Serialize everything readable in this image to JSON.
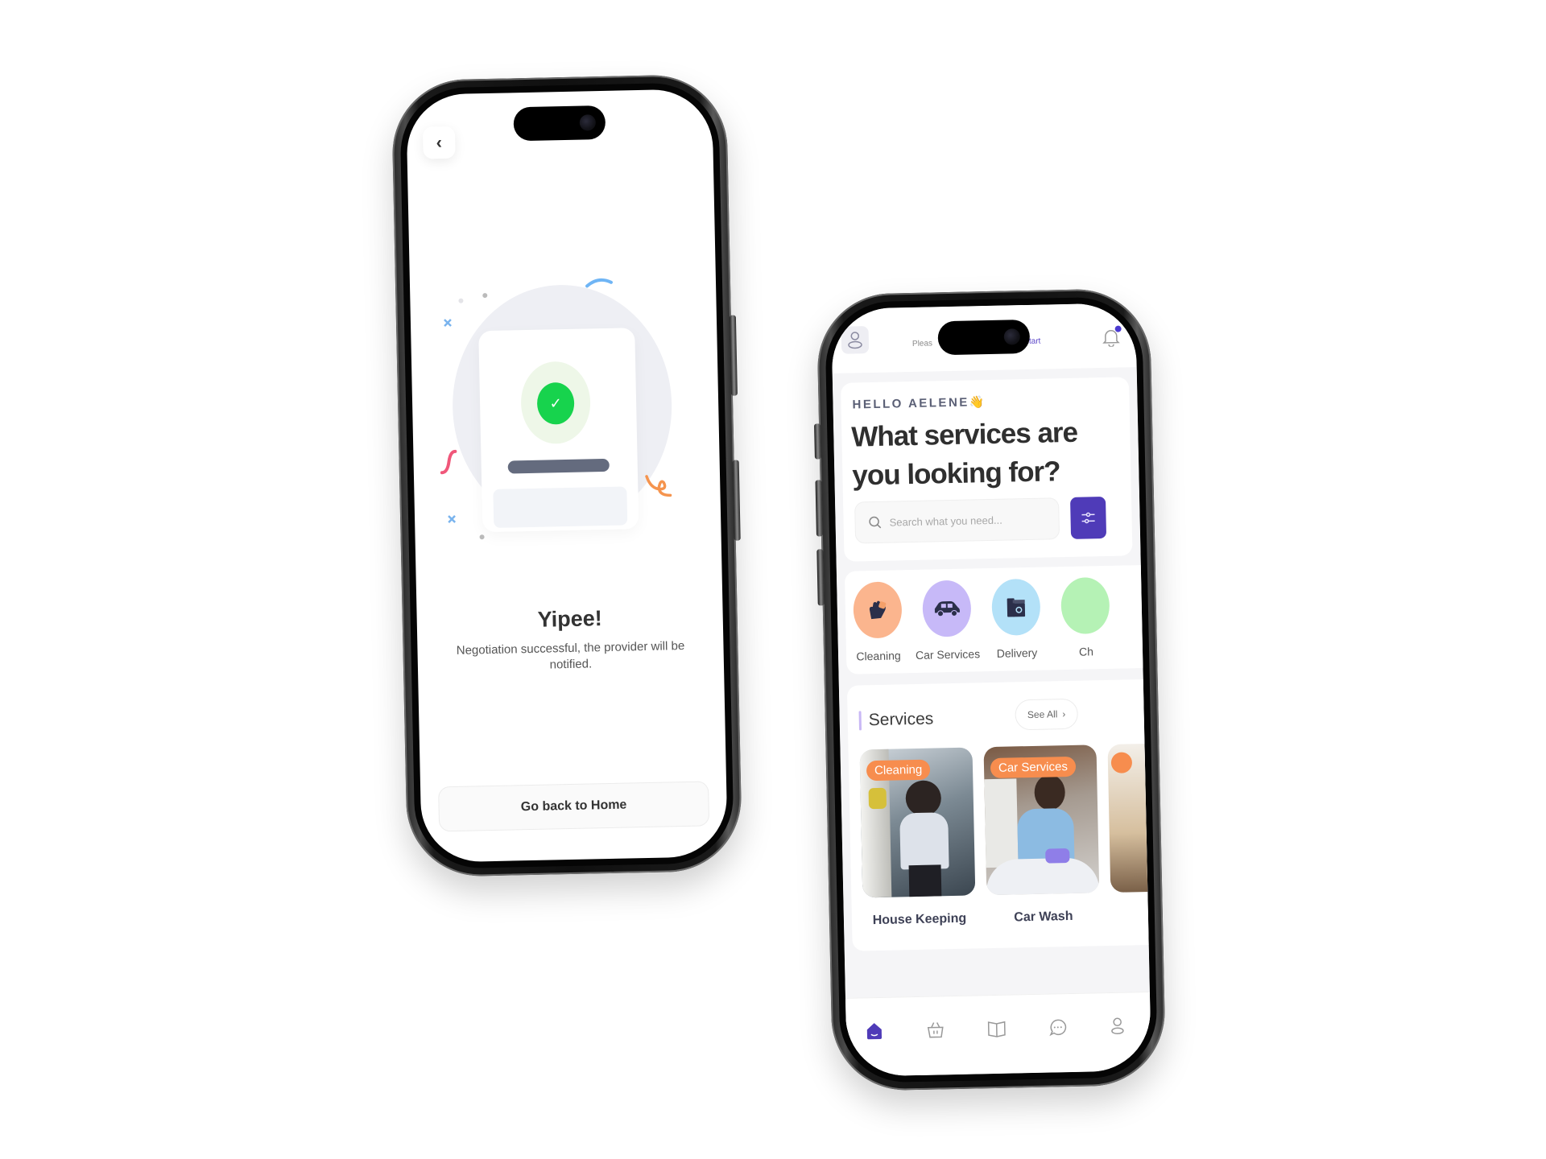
{
  "left_screen": {
    "back_icon": "chevron-left-icon",
    "illustration": {
      "icon": "check-circle-icon",
      "check_color": "#17d34d"
    },
    "title": "Yipee!",
    "message": "Negotiation successful, the provider will be notified.",
    "home_button": "Go back to Home"
  },
  "right_screen": {
    "topbar": {
      "avatar_icon": "user-icon",
      "message_start": "Pleas",
      "message_link": "start",
      "bell_icon": "bell-icon",
      "has_notification": true
    },
    "greeting": "HELLO AELENE",
    "greeting_emoji": "👋",
    "headline": "What services are you looking for?",
    "search": {
      "placeholder": "Search what you need...",
      "value": "",
      "filter_icon": "sliders-icon"
    },
    "categories": [
      {
        "label": "Cleaning",
        "icon": "cleaning-hand-icon",
        "color": "#fbb58e"
      },
      {
        "label": "Car Services",
        "icon": "car-icon",
        "color": "#c7b9f8"
      },
      {
        "label": "Delivery",
        "icon": "appliance-icon",
        "color": "#b3e1f8"
      },
      {
        "label": "Ch",
        "icon": "category-icon",
        "color": "#b5f2b5"
      }
    ],
    "services": {
      "title": "Services",
      "see_all": "See All",
      "items": [
        {
          "tag": "Cleaning",
          "name": "House Keeping"
        },
        {
          "tag": "Car Services",
          "name": "Car Wash"
        },
        {
          "tag": "",
          "name": ""
        }
      ]
    },
    "bottom_nav": [
      {
        "icon": "home-icon",
        "active": true
      },
      {
        "icon": "basket-icon",
        "active": false
      },
      {
        "icon": "book-icon",
        "active": false
      },
      {
        "icon": "chat-icon",
        "active": false
      },
      {
        "icon": "profile-icon",
        "active": false
      }
    ],
    "accent_color": "#4f3bb8",
    "tag_color": "#f78d4e"
  }
}
